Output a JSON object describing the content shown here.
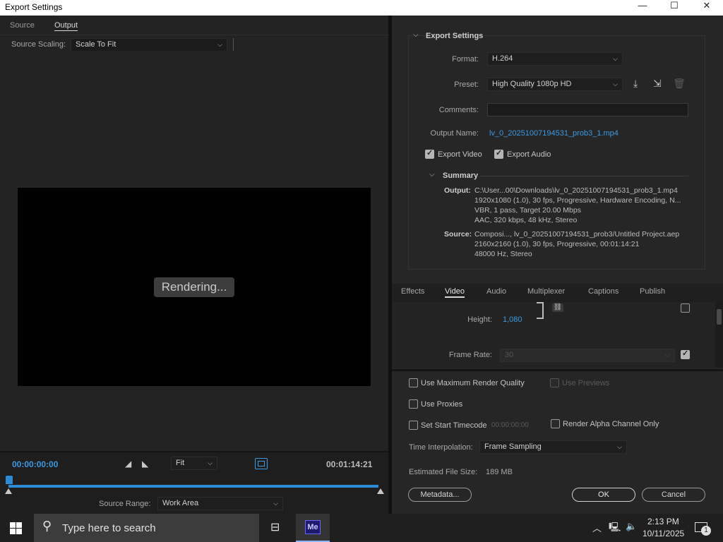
{
  "window": {
    "title": "Export Settings",
    "minimize_icon": "—",
    "maximize_icon": "☐",
    "close_icon": "✕"
  },
  "left": {
    "tabs": [
      "Source",
      "Output"
    ],
    "active_tab": "Output",
    "source_scaling_label": "Source Scaling:",
    "source_scaling_value": "Scale To Fit",
    "rendering_text": "Rendering...",
    "current_time": "00:00:00:00",
    "duration": "00:01:14:21",
    "zoom_value": "Fit",
    "source_range_label": "Source Range:",
    "source_range_value": "Work Area"
  },
  "export": {
    "section_title": "Export Settings",
    "format_label": "Format:",
    "format_value": "H.264",
    "preset_label": "Preset:",
    "preset_value": "High Quality 1080p HD",
    "comments_label": "Comments:",
    "comments_value": "",
    "output_name_label": "Output Name:",
    "output_name_value": "lv_0_20251007194531_prob3_1.mp4",
    "export_video_label": "Export Video",
    "export_audio_label": "Export Audio",
    "summary_title": "Summary",
    "summary_output_label": "Output:",
    "summary_output_lines": [
      "C:\\User...00\\Downloads\\lv_0_20251007194531_prob3_1.mp4",
      "1920x1080 (1.0), 30 fps, Progressive, Hardware Encoding, N...",
      "VBR, 1 pass, Target 20.00 Mbps",
      "AAC, 320 kbps, 48 kHz, Stereo"
    ],
    "summary_source_label": "Source:",
    "summary_source_lines": [
      "Composi..., lv_0_20251007194531_prob3/Untitled Project.aep",
      "2160x2160 (1.0), 30 fps, Progressive, 00:01:14:21",
      "48000 Hz, Stereo"
    ]
  },
  "settings_tabs": [
    "Effects",
    "Video",
    "Audio",
    "Multiplexer",
    "Captions",
    "Publish"
  ],
  "settings_active_tab": "Video",
  "video": {
    "height_label": "Height:",
    "height_value": "1,080",
    "frame_rate_label": "Frame Rate:",
    "frame_rate_value": "30"
  },
  "options": {
    "max_render_quality": "Use Maximum Render Quality",
    "use_previews": "Use Previews",
    "use_proxies": "Use Proxies",
    "set_start_timecode": "Set Start Timecode",
    "start_timecode_value": "00:00:00:00",
    "render_alpha": "Render Alpha Channel Only",
    "time_interp_label": "Time Interpolation:",
    "time_interp_value": "Frame Sampling",
    "file_size_label": "Estimated File Size:",
    "file_size_value": "189 MB",
    "metadata_button": "Metadata...",
    "ok_button": "OK",
    "cancel_button": "Cancel"
  },
  "taskbar": {
    "search_placeholder": "Type here to search",
    "app_label": "Me",
    "time": "2:13 PM",
    "date": "10/11/2025",
    "notification_count": "1"
  },
  "colors": {
    "accent_blue": "#3b9ae1",
    "media_encoder": "#1e1a6e"
  }
}
